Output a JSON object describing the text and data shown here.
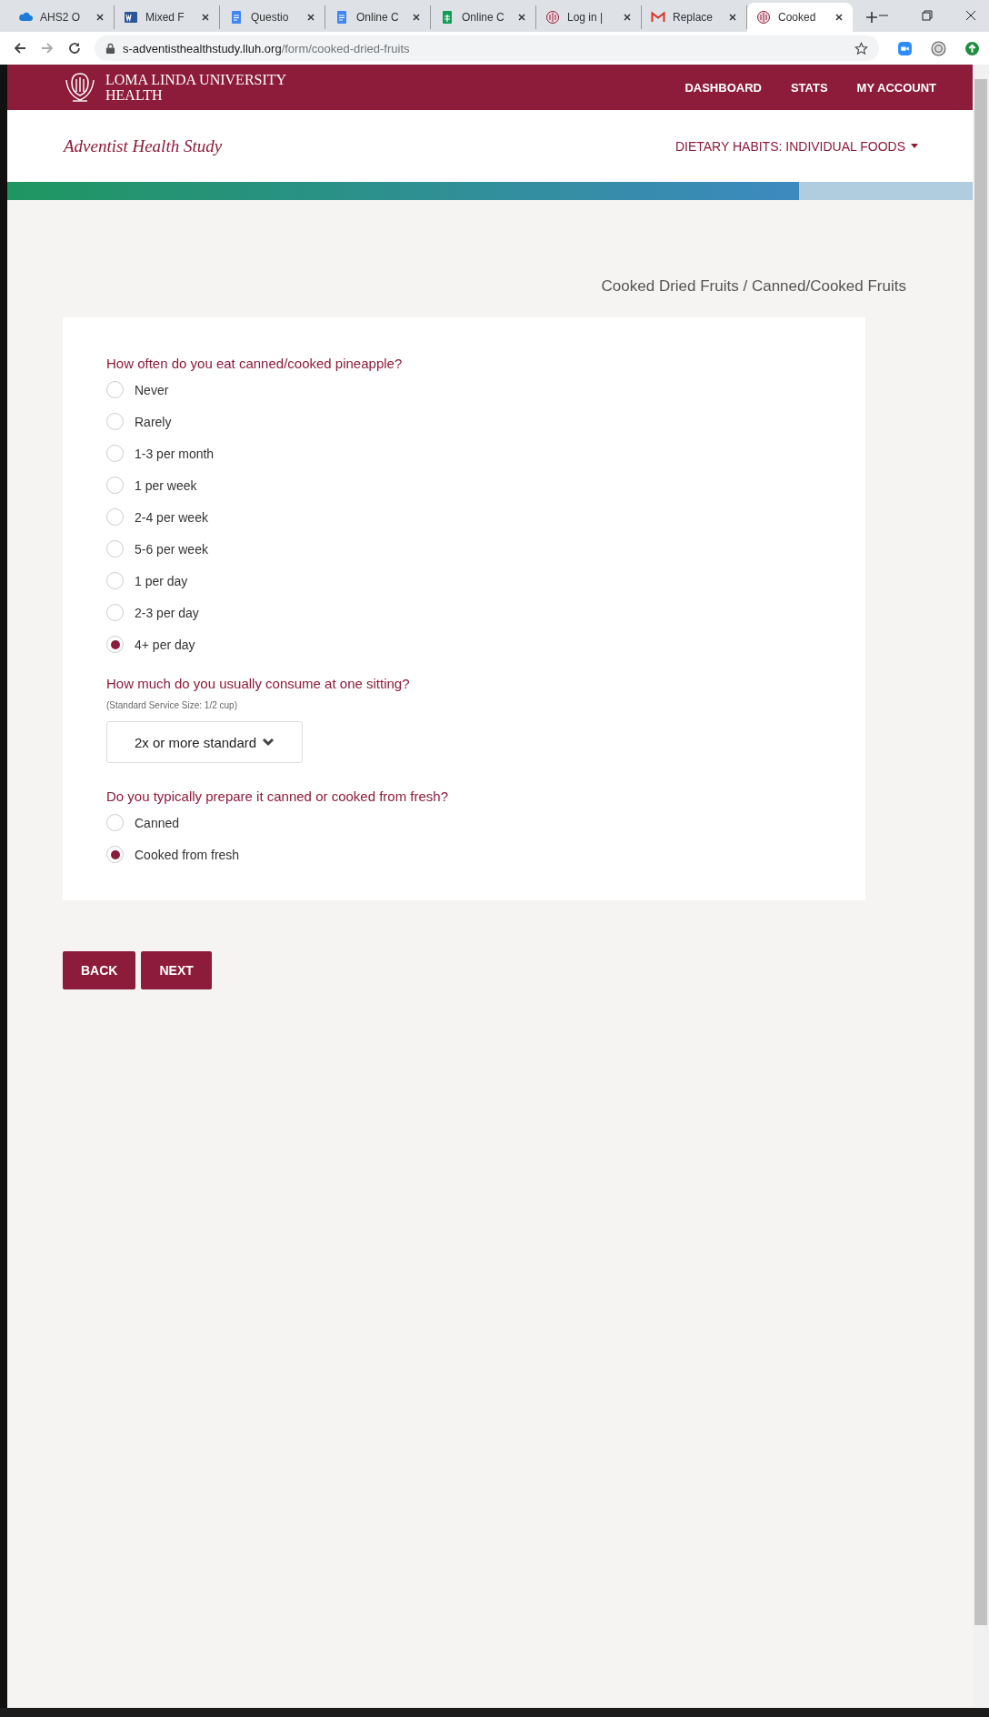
{
  "browser": {
    "tabs": [
      {
        "title": "AHS2 O",
        "kind": "cloud",
        "selected": false
      },
      {
        "title": "Mixed F",
        "kind": "word",
        "selected": false
      },
      {
        "title": "Questio",
        "kind": "docs",
        "selected": false
      },
      {
        "title": "Online C",
        "kind": "docs",
        "selected": false
      },
      {
        "title": "Online C",
        "kind": "sheets",
        "selected": false
      },
      {
        "title": "Log in |",
        "kind": "crest",
        "selected": false
      },
      {
        "title": "Replace",
        "kind": "mail",
        "selected": false
      },
      {
        "title": "Cooked",
        "kind": "crest",
        "selected": true
      }
    ],
    "url_host": "s-adventisthealthstudy.lluh.org",
    "url_path": "/form/cooked-dried-fruits"
  },
  "header": {
    "brand": [
      "LOMA LINDA UNIVERSITY",
      "HEALTH"
    ],
    "nav": [
      "DASHBOARD",
      "STATS",
      "MY ACCOUNT"
    ]
  },
  "subheader": {
    "title": "Adventist Health Study",
    "section": "DIETARY HABITS: INDIVIDUAL FOODS"
  },
  "progress": {
    "level": 0.82
  },
  "breadcrumb": "Cooked Dried Fruits / Canned/Cooked Fruits",
  "questions": [
    {
      "kind": "radio",
      "question": "How often do you eat canned/cooked pineapple?",
      "options": [
        {
          "label": "Never",
          "selected": false
        },
        {
          "label": "Rarely",
          "selected": false
        },
        {
          "label": "1-3 per month",
          "selected": false
        },
        {
          "label": "1 per week",
          "selected": false
        },
        {
          "label": "2-4 per week",
          "selected": false
        },
        {
          "label": "5-6 per week",
          "selected": false
        },
        {
          "label": "1 per day",
          "selected": false
        },
        {
          "label": "2-3 per day",
          "selected": false
        },
        {
          "label": "4+ per day",
          "selected": true
        }
      ]
    },
    {
      "kind": "select",
      "question": "How much do you usually consume at one sitting?",
      "note": "(Standard Service Size: 1/2 cup)",
      "value": "2x or more standard"
    },
    {
      "kind": "radio",
      "question": "Do you typically prepare it canned or cooked from fresh?",
      "options": [
        {
          "label": "Canned",
          "selected": false
        },
        {
          "label": "Cooked from fresh",
          "selected": true
        }
      ]
    }
  ],
  "buttons": [
    "BACK",
    "NEXT"
  ]
}
